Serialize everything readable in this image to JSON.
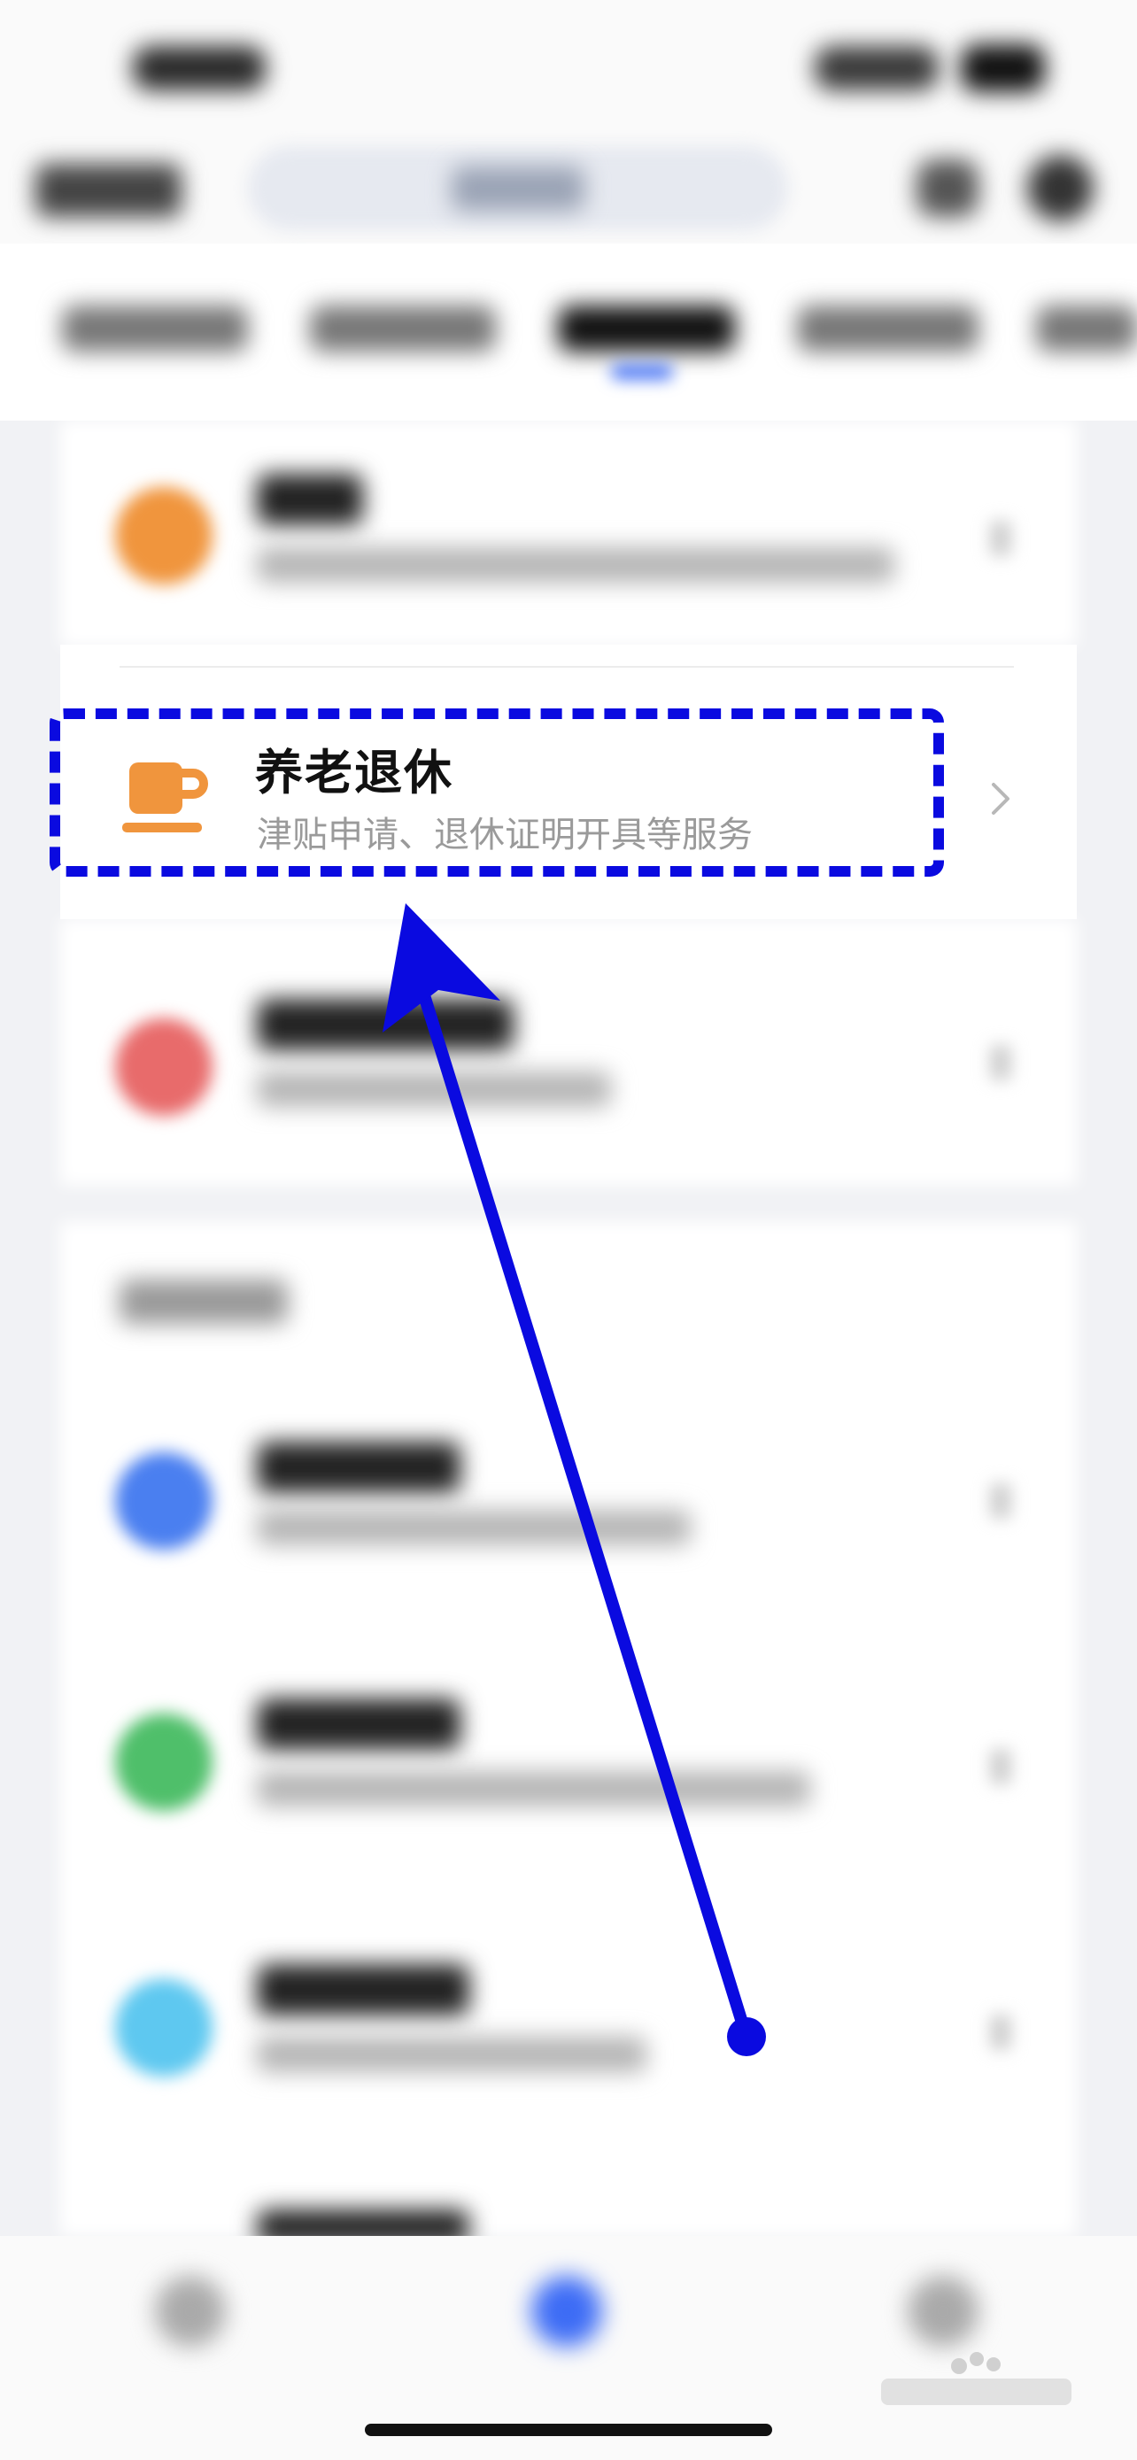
{
  "pension_item": {
    "title": "养老退休",
    "subtitle": "津贴申请、退休证明开具等服务"
  },
  "colors": {
    "highlight": "#0a0ae0",
    "pension_icon": "#f0953d",
    "accent": "#3d6cf5"
  },
  "icons": {
    "pension": "coffee-cup-icon",
    "chevron": "chevron-right-icon"
  }
}
